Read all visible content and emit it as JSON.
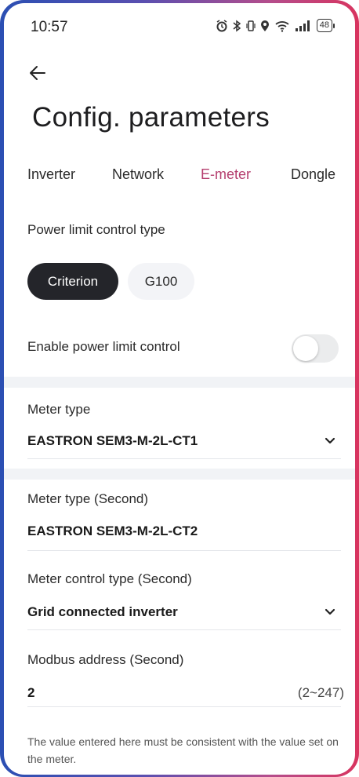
{
  "status_bar": {
    "time": "10:57",
    "battery": "48",
    "icons": [
      "alarm-icon",
      "bluetooth-icon",
      "vibrate-icon",
      "location-icon",
      "wifi-icon",
      "signal-icon",
      "battery-icon"
    ]
  },
  "header": {
    "back_icon": "arrow-left-icon",
    "title": "Config. parameters"
  },
  "tabs": [
    {
      "label": "Inverter",
      "active": false
    },
    {
      "label": "Network",
      "active": false
    },
    {
      "label": "E-meter",
      "active": true
    },
    {
      "label": "Dongle",
      "active": false
    }
  ],
  "power_limit": {
    "label": "Power limit control type",
    "options": [
      {
        "label": "Criterion",
        "selected": true
      },
      {
        "label": "G100",
        "selected": false
      }
    ],
    "enable_label": "Enable power limit control",
    "enabled": false
  },
  "meter_type": {
    "label": "Meter type",
    "value": "EASTRON SEM3-M-2L-CT1"
  },
  "meter_type_second": {
    "label": "Meter type (Second)",
    "value": "EASTRON SEM3-M-2L-CT2"
  },
  "meter_control_type_second": {
    "label": "Meter control type (Second)",
    "value": "Grid connected inverter"
  },
  "modbus_address_second": {
    "label": "Modbus address (Second)",
    "value": "2",
    "range": "(2~247)"
  },
  "helper_text": "The value entered here must be consistent with the value set on the meter.",
  "colors": {
    "accent": "#b53f6f",
    "chip_selected_bg": "#24252a",
    "chip_bg": "#f3f4f7",
    "frame_start": "#2b4fb3",
    "frame_end": "#d8345f"
  }
}
